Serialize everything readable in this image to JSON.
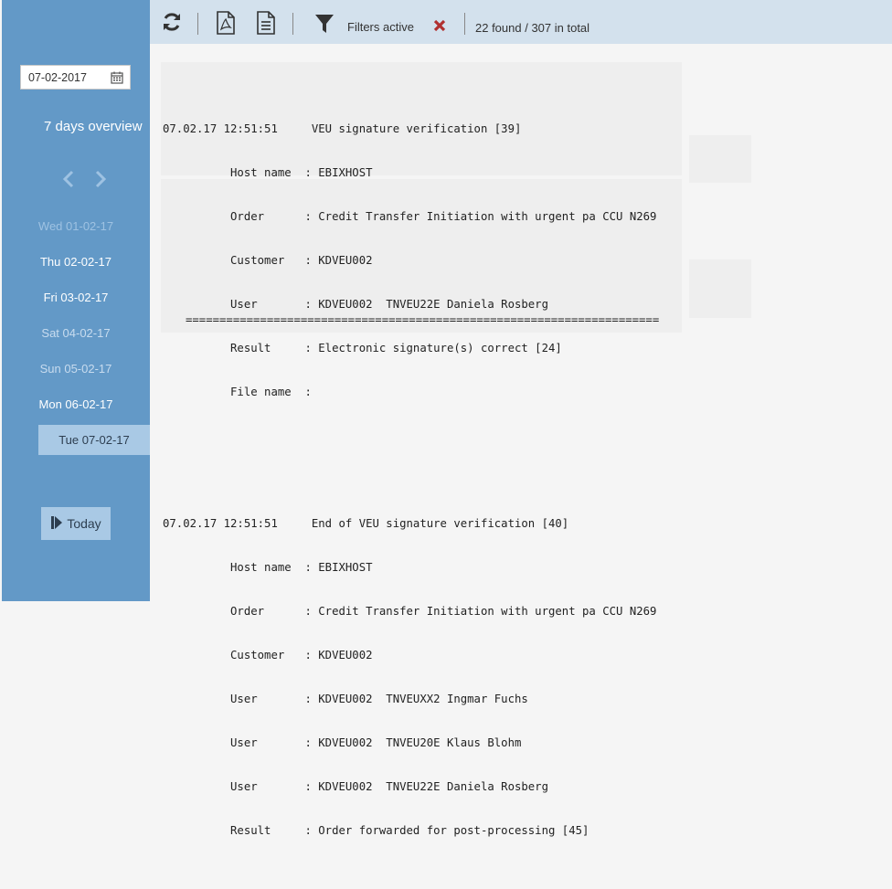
{
  "sidebar": {
    "date_value": "07-02-2017",
    "overview_title": "7 days overview",
    "days": [
      {
        "label": "Wed 01-02-17",
        "state": "dim"
      },
      {
        "label": "Thu 02-02-17",
        "state": "bold"
      },
      {
        "label": "Fri 03-02-17",
        "state": "bold"
      },
      {
        "label": "Sat 04-02-17",
        "state": "normal"
      },
      {
        "label": "Sun 05-02-17",
        "state": "normal"
      },
      {
        "label": "Mon 06-02-17",
        "state": "bold"
      },
      {
        "label": "Tue 07-02-17",
        "state": "selected"
      }
    ],
    "today_label": "Today"
  },
  "toolbar": {
    "filters_label": "Filters active",
    "count_label": "22 found / 307 in total"
  },
  "log": {
    "entries": [
      {
        "lines": [
          "07.02.17 12:51:51     VEU signature verification [39]",
          "          Host name  : EBIXHOST",
          "          Order      : Credit Transfer Initiation with urgent pa CCU N269",
          "          Customer   : KDVEU002",
          "          User       : KDVEU002  TNVEU22E Daniela Rosberg",
          "          Result     : Electronic signature(s) correct [24]",
          "          File name  :"
        ]
      },
      {
        "lines": [
          "07.02.17 12:51:51     End of VEU signature verification [40]",
          "          Host name  : EBIXHOST",
          "          Order      : Credit Transfer Initiation with urgent pa CCU N269",
          "          Customer   : KDVEU002",
          "          User       : KDVEU002  TNVEUXX2 Ingmar Fuchs",
          "          User       : KDVEU002  TNVEU20E Klaus Blohm",
          "          User       : KDVEU002  TNVEU22E Daniela Rosberg",
          "          Result     : Order forwarded for post-processing [45]"
        ]
      }
    ],
    "separator": "======================================================================"
  },
  "colors": {
    "sidebar_bg": "#6399c7",
    "toolbar_bg": "#d3e1ed",
    "selected_day_bg": "#a9c9e5",
    "close_red": "#b03030"
  },
  "icons": [
    "refresh-icon",
    "pdf-icon",
    "document-icon",
    "filter-icon",
    "close-icon",
    "calendar-icon",
    "chevron-left-icon",
    "chevron-right-icon",
    "skip-to-end-icon"
  ]
}
